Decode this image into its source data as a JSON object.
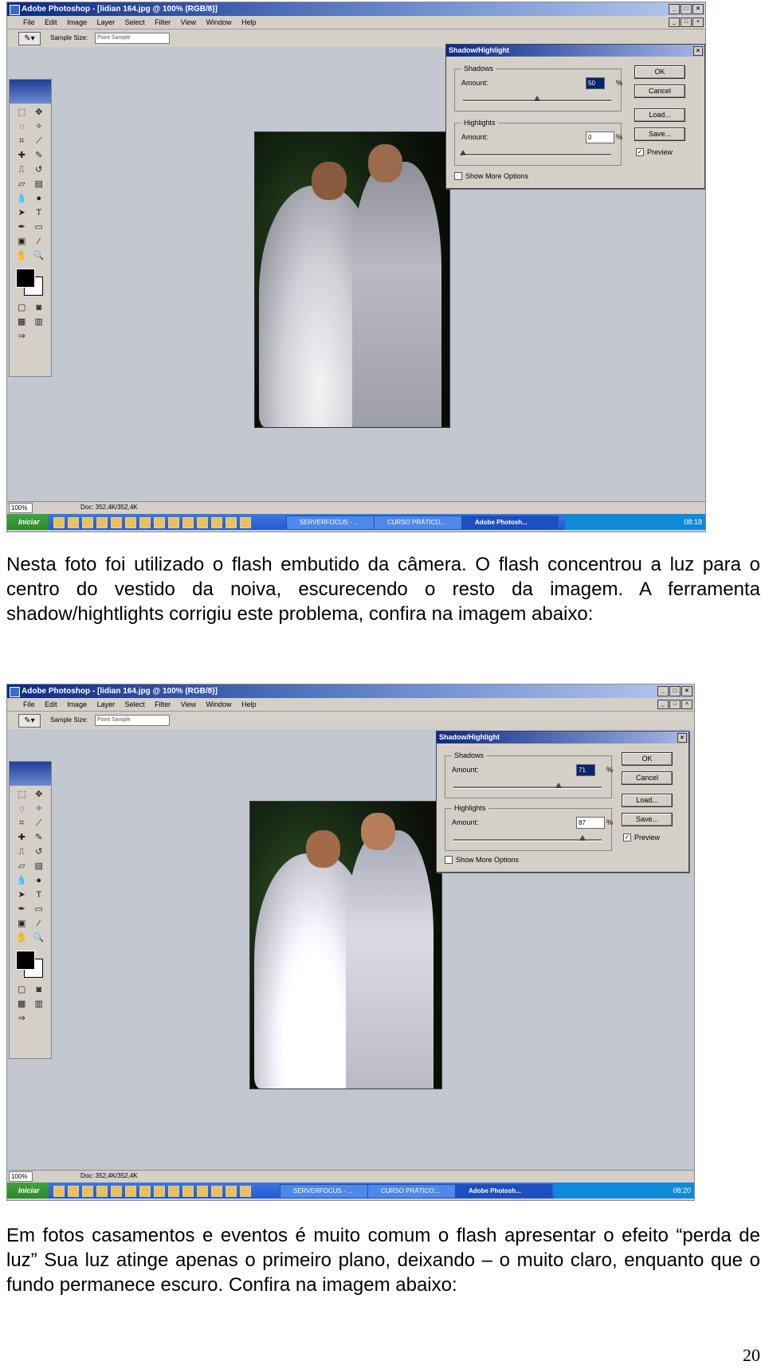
{
  "screenshots": [
    {
      "window_title": "Adobe Photoshop - [lidian 164.jpg @ 100% (RGB/8)]",
      "menu": [
        "File",
        "Edit",
        "Image",
        "Layer",
        "Select",
        "Filter",
        "View",
        "Window",
        "Help"
      ],
      "options_bar": {
        "sample_size_label": "Sample Size:",
        "sample_size_value": "Point Sample"
      },
      "dialog": {
        "title": "Shadow/Highlight",
        "shadows_label": "Shadows",
        "shadows_amount_label": "Amount:",
        "shadows_amount": "50",
        "shadows_slider_fraction": 0.5,
        "highlights_label": "Highlights",
        "highlights_amount_label": "Amount:",
        "highlights_amount": "0",
        "highlights_slider_fraction": 0.0,
        "percent": "%",
        "show_more": "Show More Options",
        "buttons": {
          "ok": "OK",
          "cancel": "Cancel",
          "load": "Load...",
          "save": "Save..."
        },
        "preview": "Preview",
        "preview_checked": true
      },
      "status": {
        "zoom": "100%",
        "doc": "Doc: 352,4K/352,4K"
      },
      "taskbar": {
        "start": "Iniciar",
        "tasks": [
          "SERVERFOCUS - ...",
          "CURSO PRÁTICO...",
          "Adobe Photosh..."
        ],
        "clock": "08:18"
      }
    },
    {
      "window_title": "Adobe Photoshop - [lidian 164.jpg @ 100% (RGB/8)]",
      "menu": [
        "File",
        "Edit",
        "Image",
        "Layer",
        "Select",
        "Filter",
        "View",
        "Window",
        "Help"
      ],
      "options_bar": {
        "sample_size_label": "Sample Size:",
        "sample_size_value": "Point Sample"
      },
      "dialog": {
        "title": "Shadow/Highlight",
        "shadows_label": "Shadows",
        "shadows_amount_label": "Amount:",
        "shadows_amount": "71",
        "shadows_slider_fraction": 0.71,
        "highlights_label": "Highlights",
        "highlights_amount_label": "Amount:",
        "highlights_amount": "87",
        "highlights_slider_fraction": 0.87,
        "percent": "%",
        "show_more": "Show More Options",
        "buttons": {
          "ok": "OK",
          "cancel": "Cancel",
          "load": "Load...",
          "save": "Save..."
        },
        "preview": "Preview",
        "preview_checked": true
      },
      "status": {
        "zoom": "100%",
        "doc": "Doc: 352,4K/352,4K"
      },
      "taskbar": {
        "start": "Iniciar",
        "tasks": [
          "SERVERFOCUS - ...",
          "CURSO PRÁTICO...",
          "Adobe Photosh..."
        ],
        "clock": "08:20"
      }
    }
  ],
  "paragraphs": [
    "Nesta foto foi utilizado o flash embutido da câmera. O flash concentrou a luz para o centro do vestido da noiva, escurecendo o resto da imagem. A ferramenta shadow/hightlights corrigiu este problema, confira na imagem abaixo:",
    "Em fotos casamentos e eventos é muito comum o flash apresentar o efeito “perda de luz” Sua luz atinge apenas o primeiro plano, deixando – o muito claro, enquanto que o fundo permanece escuro. Confira na imagem abaixo:"
  ],
  "page_number": "20"
}
